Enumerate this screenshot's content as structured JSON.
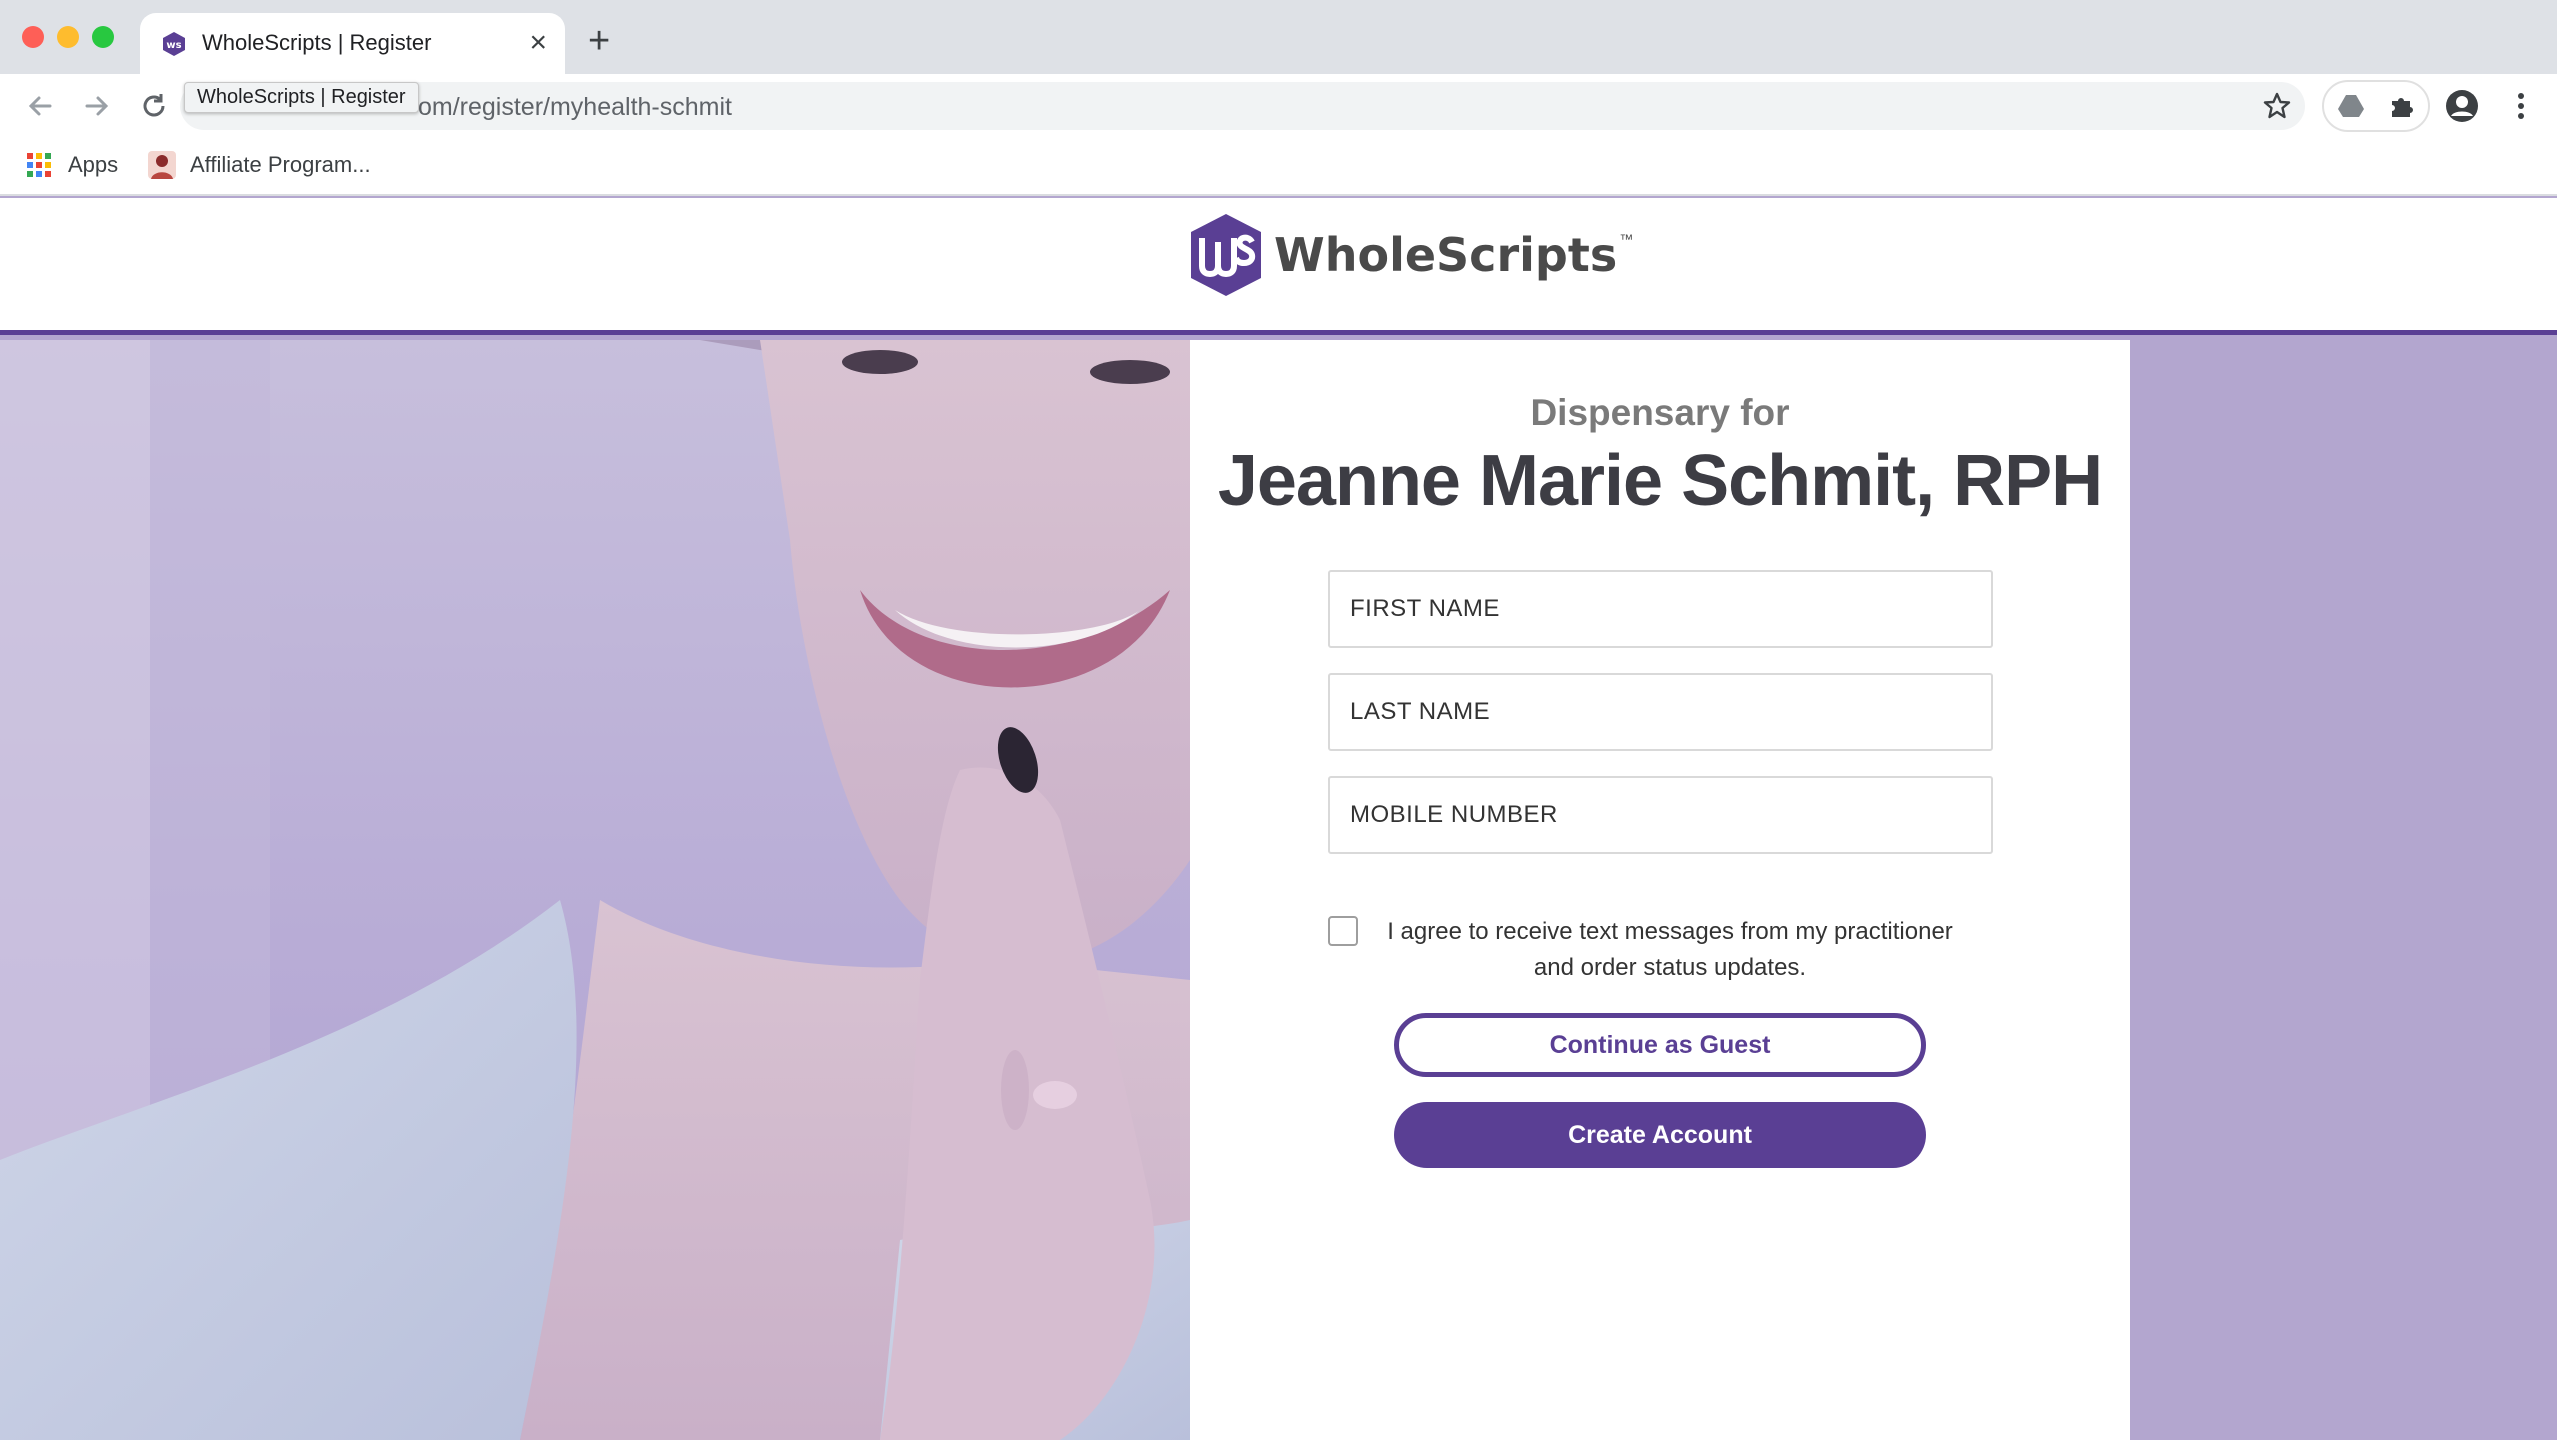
{
  "browser": {
    "tab": {
      "title": "WholeScripts | Register",
      "close_glyph": "×",
      "favicon": "wholescripts-favicon"
    },
    "new_tab_glyph": "+",
    "url_visible": "om/register/myhealth-schmit",
    "url_tooltip": "WholeScripts | Register",
    "bookmarks": [
      {
        "label": "Apps",
        "icon": "apps-grid-icon"
      },
      {
        "label": "Affiliate Program...",
        "icon": "affiliate-favicon"
      }
    ]
  },
  "brand": {
    "name": "WholeScripts",
    "trademark": "™",
    "accent_color": "#5a3f94",
    "background_tint": "#b3a6cf"
  },
  "registration": {
    "subtitle": "Dispensary for",
    "practitioner_name": "Jeanne Marie Schmit, RPH",
    "first_name_placeholder": "FIRST NAME",
    "last_name_placeholder": "LAST NAME",
    "mobile_placeholder": "MOBILE NUMBER",
    "consent_text": "I agree to receive text messages from my practitioner and order status updates.",
    "consent_checked": false,
    "guest_button_label": "Continue as Guest",
    "create_button_label": "Create Account"
  }
}
